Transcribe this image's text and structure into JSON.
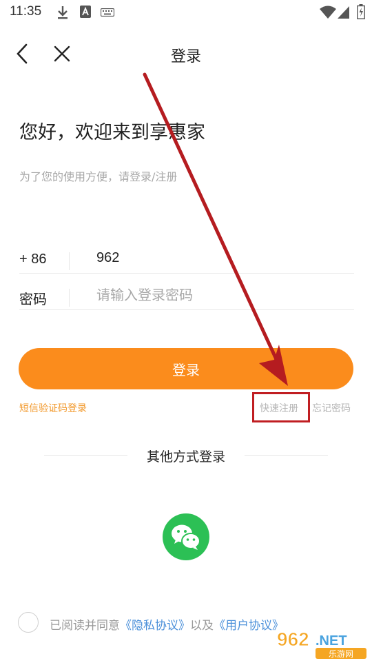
{
  "status_bar": {
    "time": "11:35",
    "icons_left": [
      "download-icon",
      "a-notification-icon",
      "keyboard-icon"
    ],
    "icons_right": [
      "wifi-icon",
      "signal-icon",
      "battery-icon"
    ]
  },
  "header": {
    "title": "登录",
    "back_icon": "chevron-left-icon",
    "close_icon": "close-icon"
  },
  "welcome": {
    "heading": "您好，欢迎来到享惠家",
    "subtitle": "为了您的使用方便，请登录/注册"
  },
  "form": {
    "country_code": "+ 86",
    "phone_value": "962",
    "password_label": "密码",
    "password_placeholder": "请输入登录密码"
  },
  "login_button": "登录",
  "links": {
    "sms_login": "短信验证码登录",
    "quick_register": "快速注册",
    "forgot_password": "忘记密码"
  },
  "other_login": {
    "title": "其他方式登录",
    "wechat_icon": "wechat-icon"
  },
  "agreement": {
    "prefix": "已阅读并同意",
    "privacy": "《隐私协议》",
    "and": "以及",
    "user": "《用户协议》"
  },
  "watermark": {
    "brand_digits": "962",
    "brand_suffix": ".NET",
    "brand_cn": "乐游网"
  },
  "colors": {
    "accent_orange": "#fb8c1c",
    "link_orange": "#f29a2e",
    "wechat_green": "#2cc055",
    "annotation_red": "#c01e22",
    "link_blue": "#4a8fd9"
  }
}
